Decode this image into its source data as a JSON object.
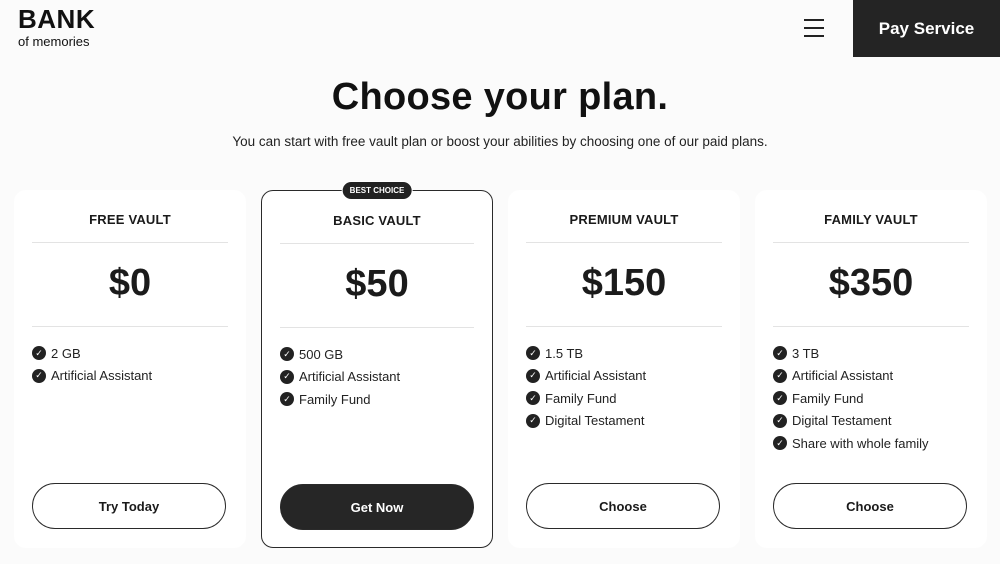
{
  "header": {
    "logo_main": "BANK",
    "logo_sub": "of memories",
    "pay_service_label": "Pay Service"
  },
  "hero": {
    "title": "Choose your plan.",
    "subtitle": "You can start with free vault plan or boost your abilities by choosing one of our paid plans."
  },
  "plans": [
    {
      "name": "FREE VAULT",
      "price": "$0",
      "features": [
        "2 GB",
        "Artificial Assistant"
      ],
      "cta": "Try Today"
    },
    {
      "name": "BASIC VAULT",
      "badge": "BEST CHOICE",
      "price": "$50",
      "features": [
        "500 GB",
        "Artificial Assistant",
        "Family Fund"
      ],
      "cta": "Get Now"
    },
    {
      "name": "PREMIUM VAULT",
      "price": "$150",
      "features": [
        "1.5 TB",
        "Artificial Assistant",
        "Family Fund",
        "Digital Testament"
      ],
      "cta": "Choose"
    },
    {
      "name": "FAMILY VAULT",
      "price": "$350",
      "features": [
        "3 TB",
        "Artificial Assistant",
        "Family Fund",
        "Digital Testament",
        "Share with whole family"
      ],
      "cta": "Choose"
    }
  ],
  "icons": {
    "menu": "hamburger-menu-icon",
    "feature_check": "check-circle-icon"
  },
  "colors": {
    "accent_dark": "#242424",
    "background": "#fbfbfb",
    "card": "#ffffff"
  }
}
